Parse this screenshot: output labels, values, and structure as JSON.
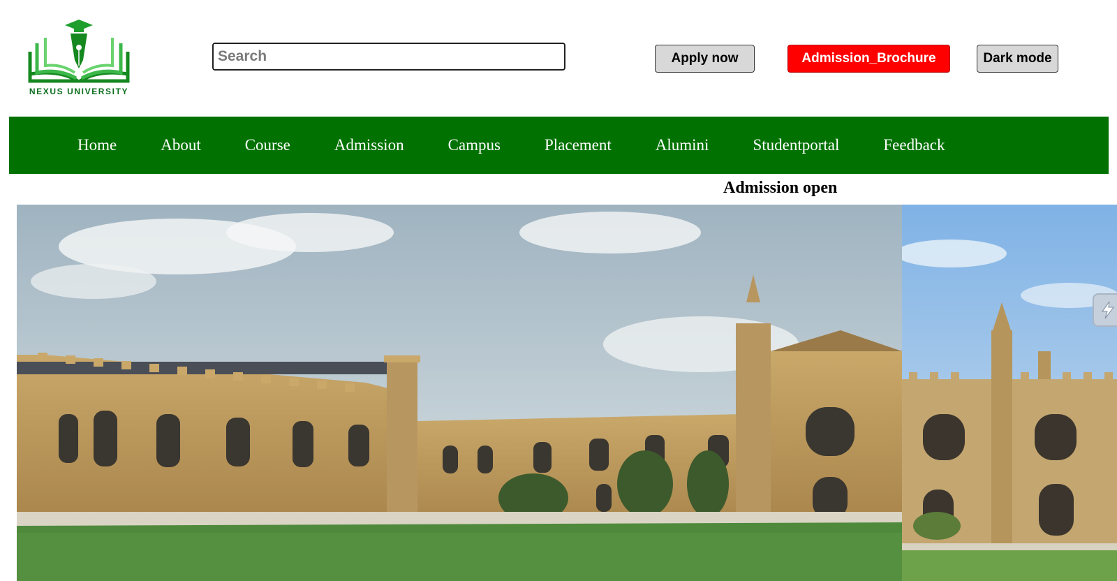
{
  "logo": {
    "icon": "open-book-pen-icon",
    "text": "NEXUS UNIVERSITY",
    "color": "#0b6e1d"
  },
  "search": {
    "placeholder": "Search",
    "value": ""
  },
  "header_buttons": {
    "apply": "Apply now",
    "brochure": "Admission_Brochure",
    "dark_mode": "Dark mode"
  },
  "nav": {
    "background": "#017201",
    "items": [
      "Home",
      "About",
      "Course",
      "Admission",
      "Campus",
      "Placement",
      "Alumini",
      "Studentportal",
      "Feedback"
    ]
  },
  "marquee": {
    "text": "Admission open"
  },
  "slider": {
    "images": [
      "campus-quad-photo",
      "campus-building-photo"
    ]
  },
  "colors": {
    "brochure_button": "#ff0000",
    "neutral_button": "#d8d8d8",
    "brand_green": "#017201"
  }
}
